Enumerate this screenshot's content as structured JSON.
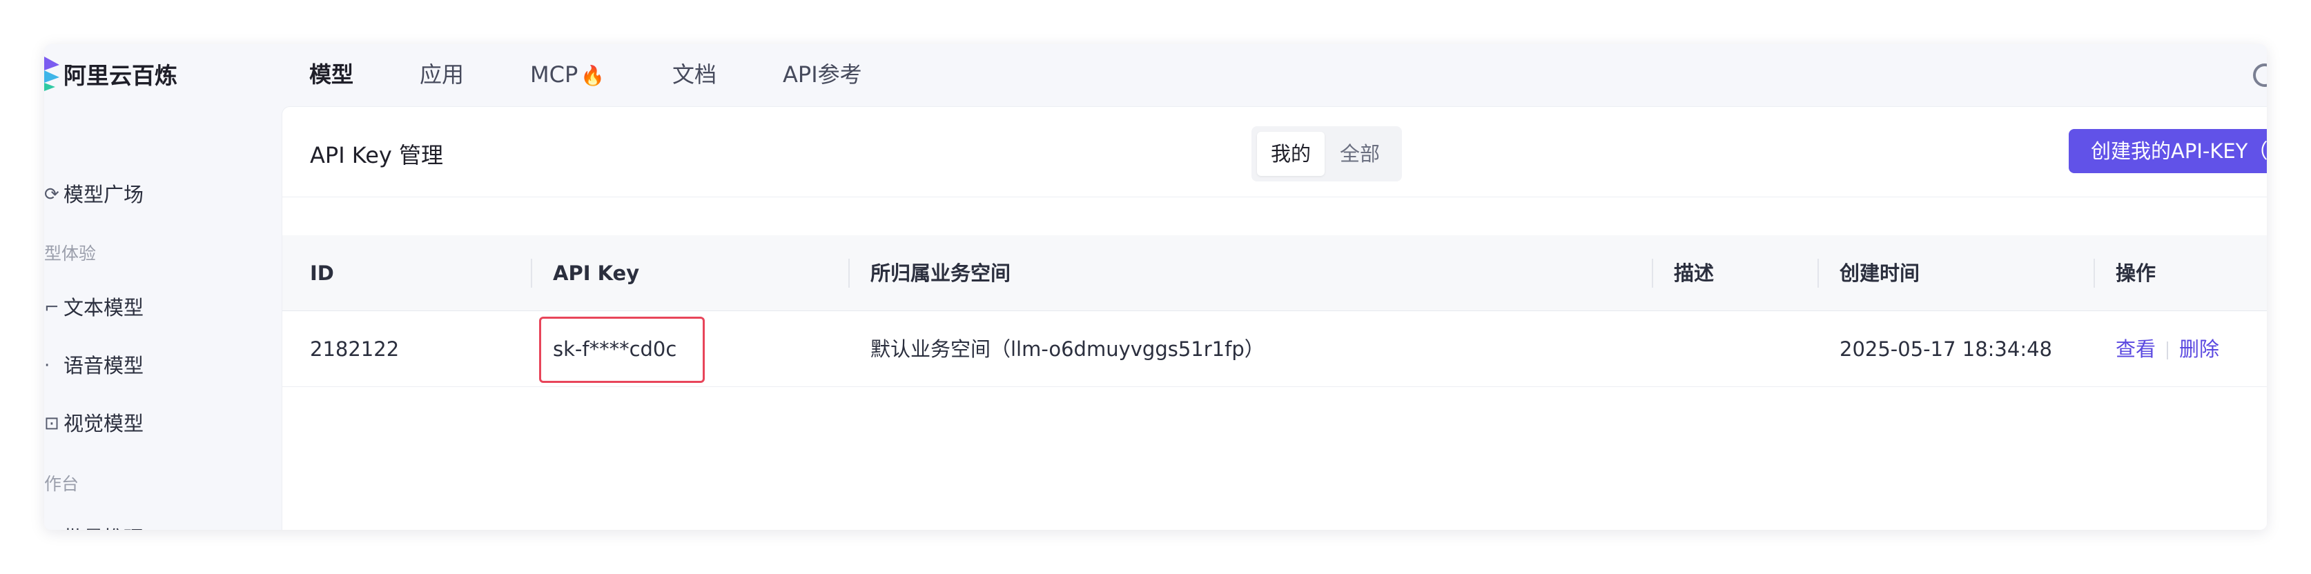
{
  "app": {
    "logo_text": "阿里云百炼"
  },
  "topnav": {
    "items": [
      {
        "label": "模型"
      },
      {
        "label": "应用"
      },
      {
        "label": "MCP"
      },
      {
        "label": "文档"
      },
      {
        "label": "API参考"
      }
    ],
    "mcp_badge": "🔥"
  },
  "sidebar": {
    "items": [
      {
        "label": "模型广场",
        "icon": "plaza-icon"
      },
      {
        "label": "文本模型",
        "icon": "text-model-icon"
      },
      {
        "label": "语音模型",
        "icon": "voice-model-icon"
      },
      {
        "label": "视觉模型",
        "icon": "vision-model-icon"
      },
      {
        "label": "批量推理",
        "icon": "batch-icon"
      }
    ],
    "sections": [
      "型体验",
      "作台"
    ]
  },
  "main": {
    "title": "API Key 管理",
    "segment": {
      "options": [
        "我的",
        "全部"
      ],
      "selected": "我的"
    },
    "create_button": "创建我的API-KEY（",
    "table": {
      "columns": [
        "ID",
        "API Key",
        "所归属业务空间",
        "描述",
        "创建时间",
        "操作"
      ],
      "rows": [
        {
          "id": "2182122",
          "api_key": "sk-f****cd0c",
          "workspace": "默认业务空间（llm-o6dmuyvggs51r1fp）",
          "description": "",
          "created": "2025-05-17 18:34:48",
          "actions": [
            "查看",
            "删除"
          ]
        }
      ]
    }
  },
  "colors": {
    "accent": "#6152e8",
    "highlight_box": "#e8455a",
    "link": "#5a48e0"
  }
}
